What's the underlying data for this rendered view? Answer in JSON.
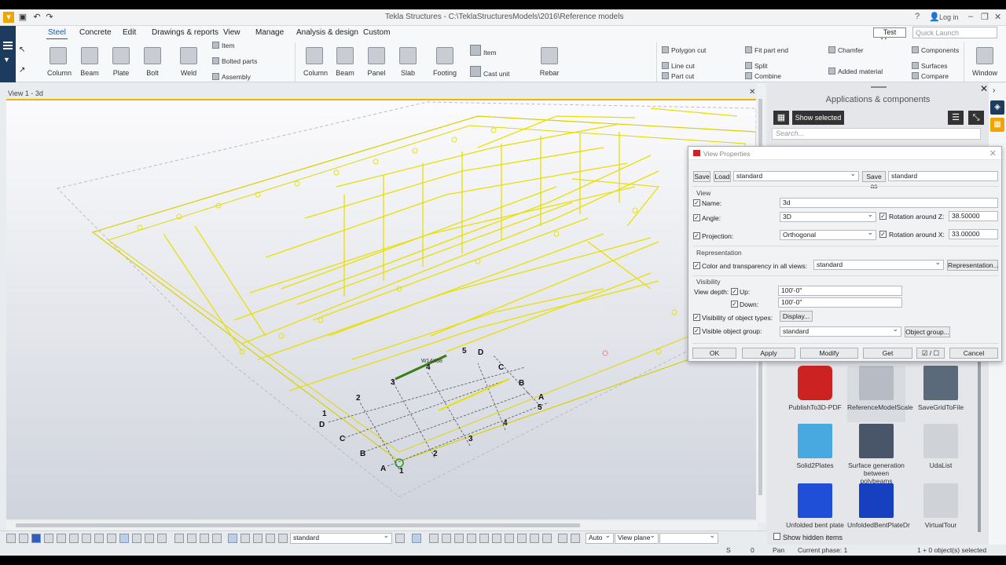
{
  "app": {
    "title": "Tekla Structures - C:\\TeklaStructuresModels\\2016\\Reference models",
    "login": "Log in",
    "test_menu": "Test Menu",
    "quick_launch": "Quick Launch"
  },
  "tabs": [
    "Steel",
    "Concrete",
    "Edit",
    "Drawings & reports",
    "View",
    "Manage",
    "Analysis & design",
    "Custom"
  ],
  "ribbon": {
    "steel": [
      "Column",
      "Beam",
      "Plate",
      "Bolt",
      "Weld"
    ],
    "steel_small": [
      "Item",
      "Bolted parts",
      "Assembly"
    ],
    "concrete": [
      "Column",
      "Beam",
      "Panel",
      "Slab",
      "Footing",
      "Rebar"
    ],
    "concrete_small": [
      "Item",
      "Cast unit"
    ],
    "edit": [
      "Polygon cut",
      "Line cut",
      "Part cut",
      "Fit part end",
      "Split",
      "Combine",
      "Chamfer",
      "Added material",
      "Components",
      "Surfaces",
      "Compare"
    ],
    "window": "Window"
  },
  "view": {
    "title": "View 1 - 3d",
    "beam_label": "W14X68",
    "grid_labels": [
      "5",
      "D",
      "4",
      "C",
      "3",
      "B",
      "2",
      "A",
      "5",
      "1",
      "D",
      "4",
      "C",
      "3",
      "B",
      "2",
      "A",
      "1"
    ]
  },
  "panel": {
    "title": "Applications & components",
    "show_selected": "Show selected",
    "search": "Search...",
    "items": [
      "PublishTo3D-PDF",
      "ReferenceModelScale",
      "SaveGridToFile",
      "Solid2Plates",
      "Surface generation between polybeams",
      "UdaList",
      "Unfolded bent plate",
      "UnfoldedBentPlateDr",
      "VirtualTour"
    ],
    "show_hidden": "Show hidden items"
  },
  "dialog": {
    "title": "View Properties",
    "save": "Save",
    "load": "Load",
    "load_value": "standard",
    "save_as": "Save as",
    "save_as_value": "standard",
    "view_group": "View",
    "name_label": "Name:",
    "name_value": "3d",
    "angle_label": "Angle:",
    "angle_value": "3D",
    "rot_z_label": "Rotation around Z:",
    "rot_z_value": "38.50000",
    "projection_label": "Projection:",
    "projection_value": "Orthogonal",
    "rot_x_label": "Rotation around X:",
    "rot_x_value": "33.00000",
    "repr_group": "Representation",
    "color_label": "Color and transparency in all views:",
    "color_value": "standard",
    "repr_button": "Representation...",
    "vis_group": "Visibility",
    "depth_label": "View depth:",
    "up_label": "Up:",
    "up_value": "100'-0\"",
    "down_label": "Down:",
    "down_value": "100'-0\"",
    "obj_types_label": "Visibility of object types:",
    "display_button": "Display...",
    "obj_group_label": "Visible object group:",
    "obj_group_value": "standard",
    "obj_group_button": "Object group...",
    "ok": "OK",
    "apply": "Apply",
    "modify": "Modify",
    "get": "Get",
    "toggle": "☑ / ☐",
    "cancel": "Cancel"
  },
  "bottom": {
    "filter": "standard",
    "auto": "Auto",
    "plane": "View plane",
    "command": ""
  },
  "status": {
    "s": "S",
    "zero": "0",
    "mode": "Pan",
    "phase": "Current phase: 1",
    "selection": "1 + 0 object(s) selected"
  }
}
